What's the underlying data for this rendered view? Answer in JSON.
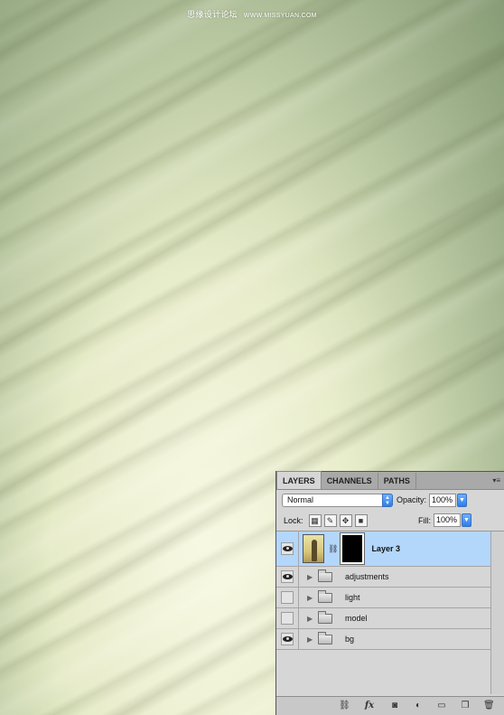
{
  "watermark": {
    "text": "思缘设计论坛",
    "url": "WWW.MISSYUAN.COM"
  },
  "panel": {
    "tabs": [
      {
        "label": "LAYERS",
        "active": true
      },
      {
        "label": "CHANNELS",
        "active": false
      },
      {
        "label": "PATHS",
        "active": false
      }
    ],
    "menu_glyph": "▾≡",
    "blend_mode": "Normal",
    "opacity_label": "Opacity:",
    "opacity_value": "100%",
    "lock_label": "Lock:",
    "fill_label": "Fill:",
    "fill_value": "100%",
    "layers": [
      {
        "name": "Layer 3",
        "visible": true,
        "selected": true,
        "type": "layer"
      },
      {
        "name": "adjustments",
        "visible": true,
        "type": "group"
      },
      {
        "name": "light",
        "visible": false,
        "type": "group"
      },
      {
        "name": "model",
        "visible": false,
        "type": "group"
      },
      {
        "name": "bg",
        "visible": true,
        "type": "group"
      }
    ],
    "bottom_icons": [
      "link-layers-icon",
      "fx-icon",
      "add-mask-icon",
      "adjustment-layer-icon",
      "new-group-icon",
      "new-layer-icon",
      "trash-icon"
    ],
    "fx_label": "fx"
  },
  "colors": {
    "selected_row": "#b3d6fb",
    "accent_blue": "#2d7fe8"
  }
}
